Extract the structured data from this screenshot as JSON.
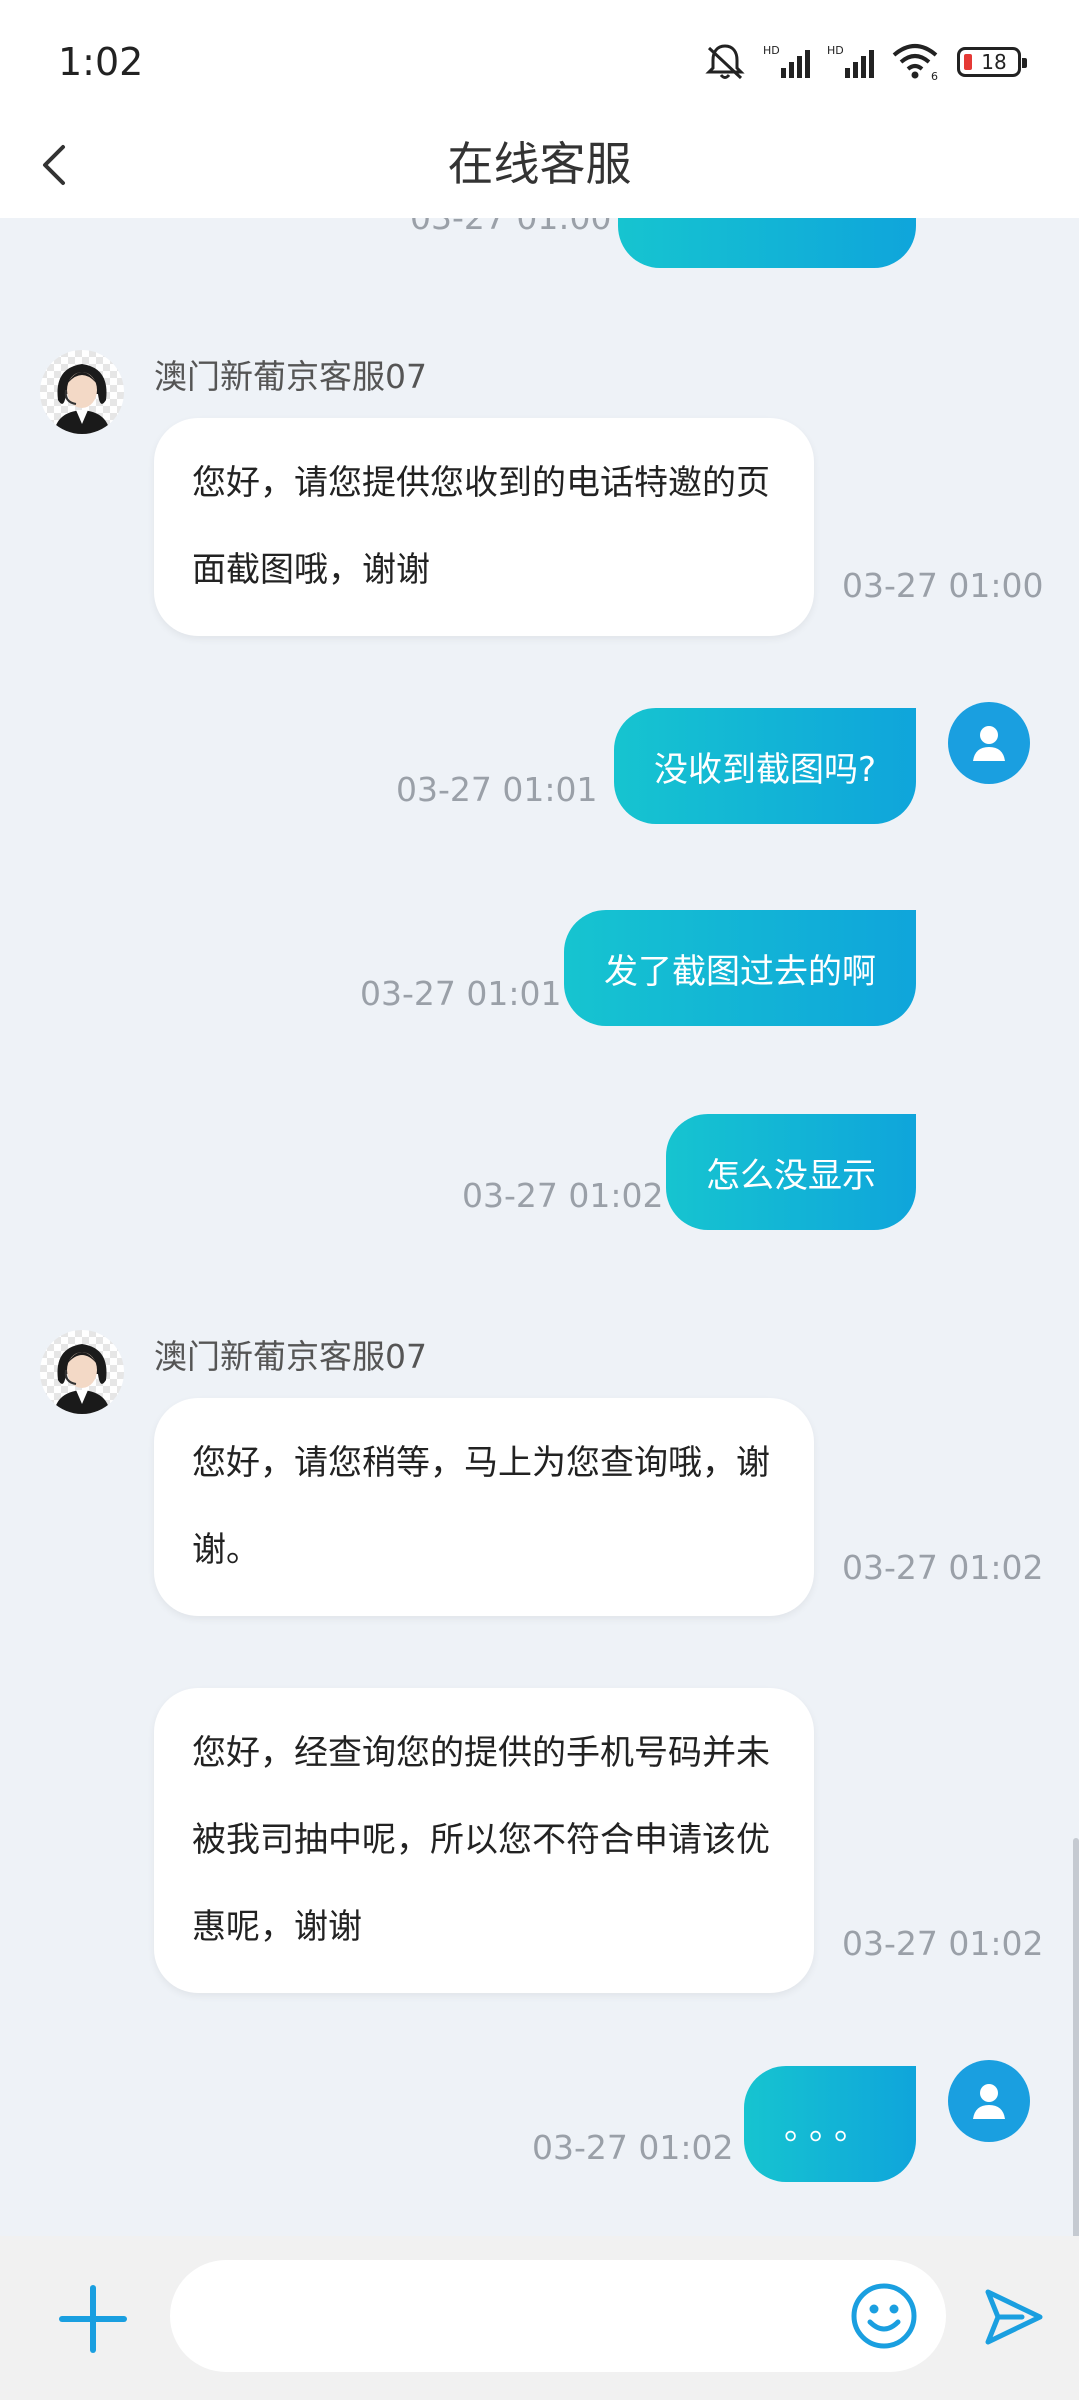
{
  "status_bar": {
    "time": "1:02",
    "battery": "18",
    "network": "HD",
    "wifi_badge": "6"
  },
  "header": {
    "title": "在线客服"
  },
  "messages": [
    {
      "type": "out",
      "text": "",
      "time": "03-27 01:00"
    },
    {
      "type": "in",
      "sender": "澳门新葡京客服07",
      "text": "您好，请您提供您收到的电话特邀的页面截图哦，谢谢",
      "time": "03-27 01:00"
    },
    {
      "type": "out",
      "text": "没收到截图吗?",
      "time": "03-27 01:01"
    },
    {
      "type": "out",
      "text": "发了截图过去的啊",
      "time": "03-27 01:01"
    },
    {
      "type": "out",
      "text": "怎么没显示",
      "time": "03-27 01:02"
    },
    {
      "type": "in",
      "sender": "澳门新葡京客服07",
      "text": "您好，请您稍等，马上为您查询哦，谢谢。",
      "time": "03-27 01:02"
    },
    {
      "type": "in",
      "text": "您好，经查询您的提供的手机号码并未被我司抽中呢，所以您不符合申请该优惠呢，谢谢",
      "time": "03-27 01:02"
    },
    {
      "type": "out",
      "text": "。。。",
      "time": "03-27 01:02"
    }
  ],
  "input": {
    "placeholder": "",
    "value": ""
  },
  "icons": {
    "back": "chevron-left-icon",
    "plus": "plus-icon",
    "emoji": "smiley-icon",
    "send": "send-icon",
    "user_avatar": "person-icon"
  },
  "colors": {
    "accent_start": "#16c4d0",
    "accent_end": "#0fa5db",
    "icon_blue": "#1a9fe0",
    "background": "#eef2f7"
  }
}
